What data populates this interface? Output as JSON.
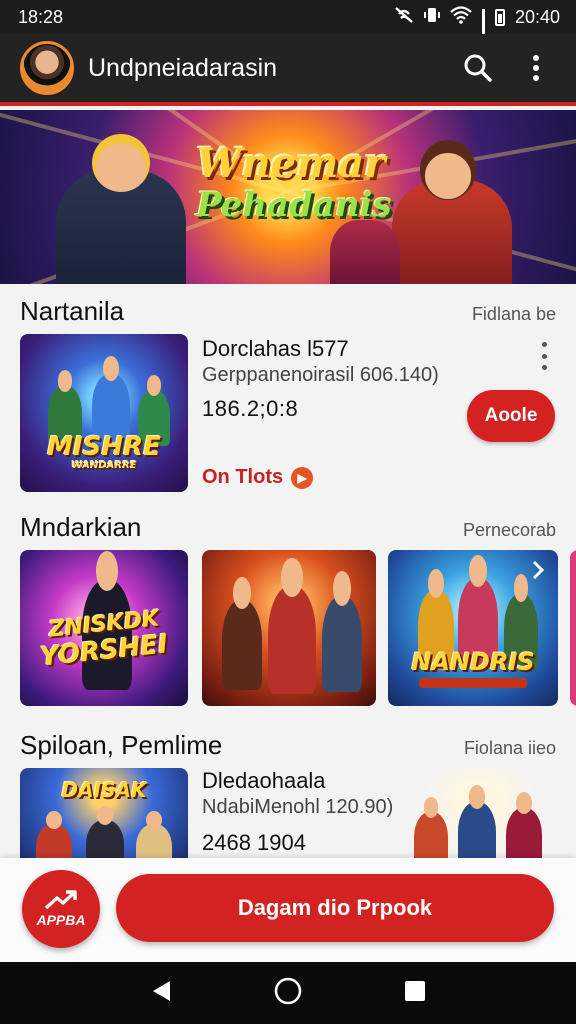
{
  "status_bar": {
    "time": "18:28",
    "clock_right": "20:40",
    "icons": [
      "no-signal-icon",
      "vibrate-icon",
      "wifi-icon",
      "cell-signal-icon",
      "battery-icon"
    ]
  },
  "app_bar": {
    "title": "Undpneiadarasin",
    "icons": [
      "search-icon",
      "more-vert-icon"
    ]
  },
  "hero": {
    "title_line1": "Wnemar",
    "title_line2": "Pehadanis"
  },
  "section1": {
    "title": "Nartanila",
    "link": "Fidlana be",
    "featured": {
      "title": "Dorclahas l577",
      "subtitle": "Gerppanenoirasil 606.140)",
      "price": "186.2;0:8",
      "button": "Aoole",
      "link": "On Tlots",
      "thumb_logo_line1": "MISHRE",
      "thumb_logo_line2": "WANDARRE"
    }
  },
  "section2": {
    "title": "Mndarkian",
    "link": "Pernecorab",
    "thumbs": [
      {
        "logo_line1": "ZNISKDK",
        "logo_line2": "YORSHEI"
      },
      {
        "logo_line1": "",
        "logo_line2": ""
      },
      {
        "logo_line1": "NANDRIS",
        "logo_line2": ""
      }
    ]
  },
  "section3": {
    "title": "Spiloan, Pemlime",
    "link": "Fiolana iieo",
    "item": {
      "title": "Dledaohaala",
      "subtitle": "NdabiMenohl 120.90)",
      "price": "2468 1904",
      "thumb_logo": "DAISAK"
    }
  },
  "bottom_bar": {
    "fab_label": "APPBA",
    "cta_label": "Dagam dio Prpook"
  },
  "colors": {
    "accent": "#d32222",
    "app_bar": "#232323",
    "background": "#f3f3f3"
  }
}
